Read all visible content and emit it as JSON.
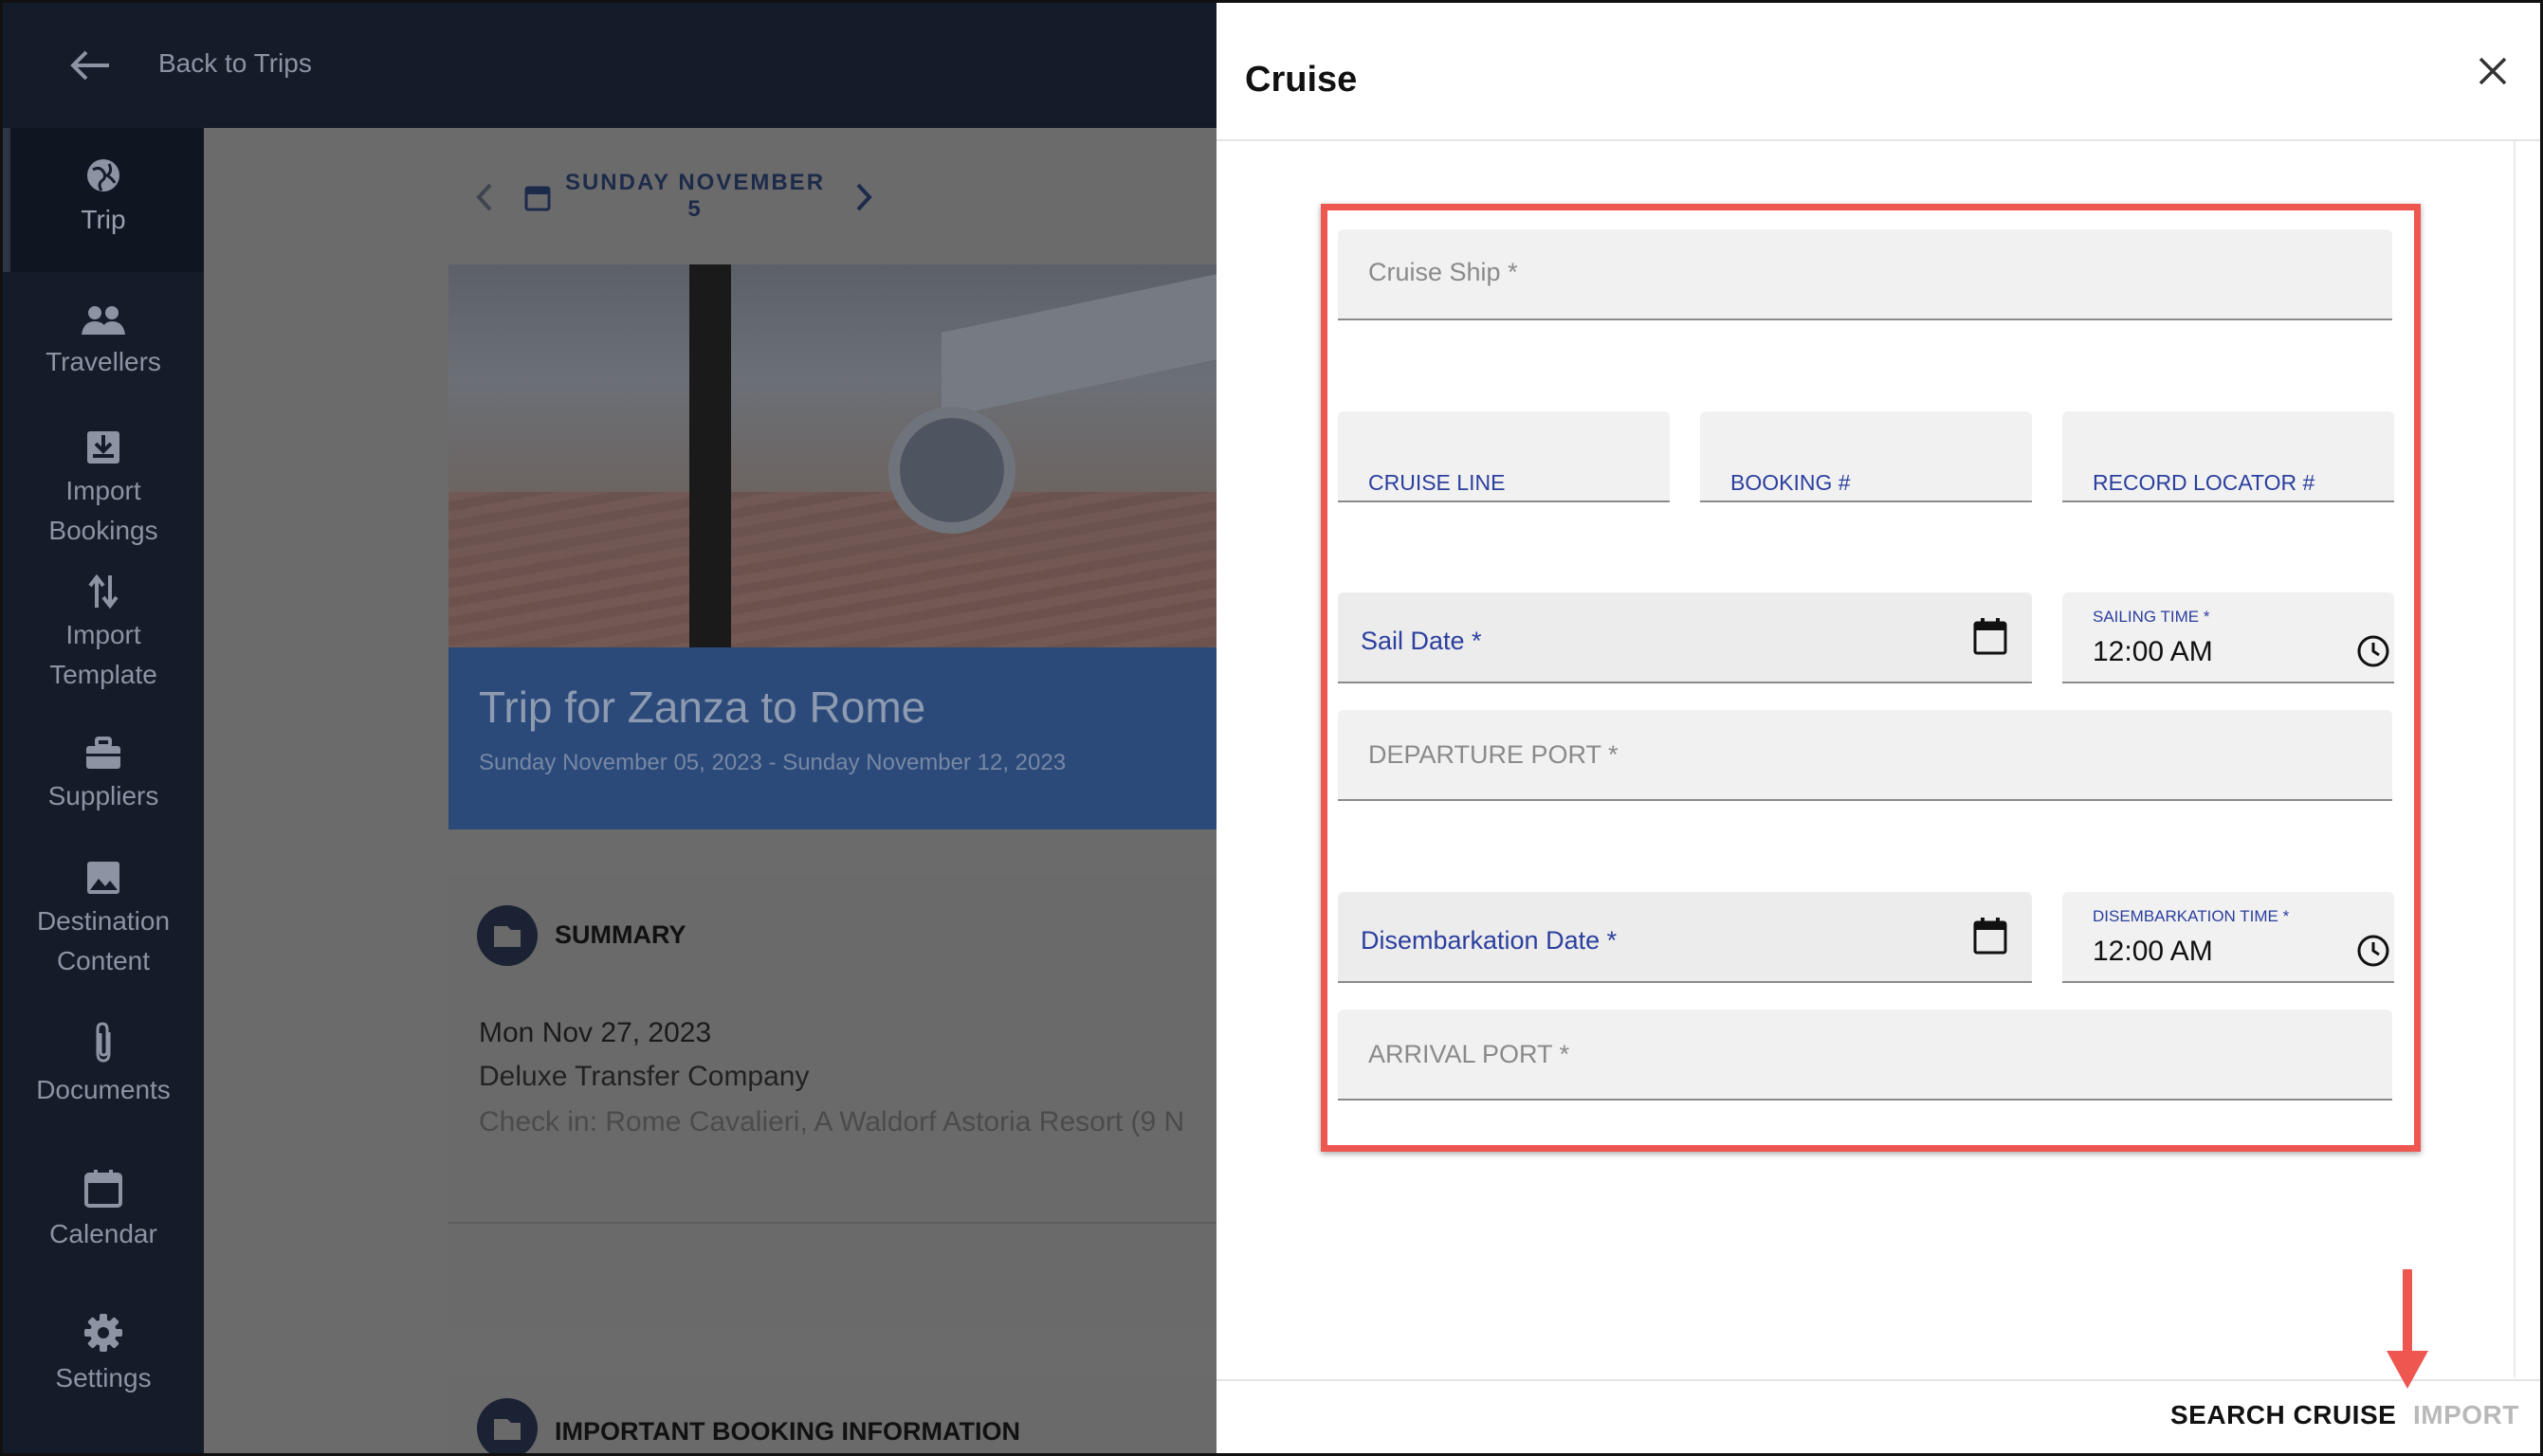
{
  "topbar": {
    "back_label": "Back to Trips"
  },
  "sidebar": {
    "items": [
      {
        "label": "Trip",
        "icon": "globe-icon"
      },
      {
        "label": "Travellers",
        "icon": "people-icon"
      },
      {
        "label": "Import Bookings",
        "icon": "import-icon"
      },
      {
        "label": "Import Template",
        "icon": "swap-vertical-icon"
      },
      {
        "label": "Suppliers",
        "icon": "briefcase-icon"
      },
      {
        "label": "Destination Content",
        "icon": "image-icon"
      },
      {
        "label": "Documents",
        "icon": "paperclip-icon"
      },
      {
        "label": "Calendar",
        "icon": "calendar-icon"
      },
      {
        "label": "Settings",
        "icon": "gear-icon"
      }
    ]
  },
  "main": {
    "date_line1": "SUNDAY NOVEMBER",
    "date_line2": "5",
    "trip_title": "Trip for Zanza to Rome",
    "trip_dates": "Sunday November 05, 2023 - Sunday November 12, 2023",
    "summary": {
      "heading": "SUMMARY",
      "date": "Mon Nov 27, 2023",
      "company": "Deluxe Transfer Company",
      "checkin": "Check in: Rome Cavalieri, A Waldorf Astoria Resort (9 N"
    },
    "booking_info_heading": "IMPORTANT BOOKING INFORMATION"
  },
  "dialog": {
    "title": "Cruise",
    "fields": {
      "cruise_ship": "Cruise Ship *",
      "cruise_line": "CRUISE LINE",
      "booking": "BOOKING #",
      "record_locator": "RECORD LOCATOR #",
      "sail_date": "Sail Date *",
      "sailing_time_label": "SAILING TIME *",
      "sailing_time_value": "12:00 AM",
      "departure_port": "DEPARTURE PORT *",
      "disembarkation_date": "Disembarkation Date *",
      "disembarkation_time_label": "DISEMBARKATION TIME *",
      "disembarkation_time_value": "12:00 AM",
      "arrival_port": "ARRIVAL PORT *"
    },
    "footer": {
      "search_label": "SEARCH CRUISE",
      "import_label": "IMPORT"
    }
  },
  "colors": {
    "highlight": "#ee5650",
    "field_label_blue": "#2b3f9e",
    "sidebar_bg": "#141c2a"
  }
}
